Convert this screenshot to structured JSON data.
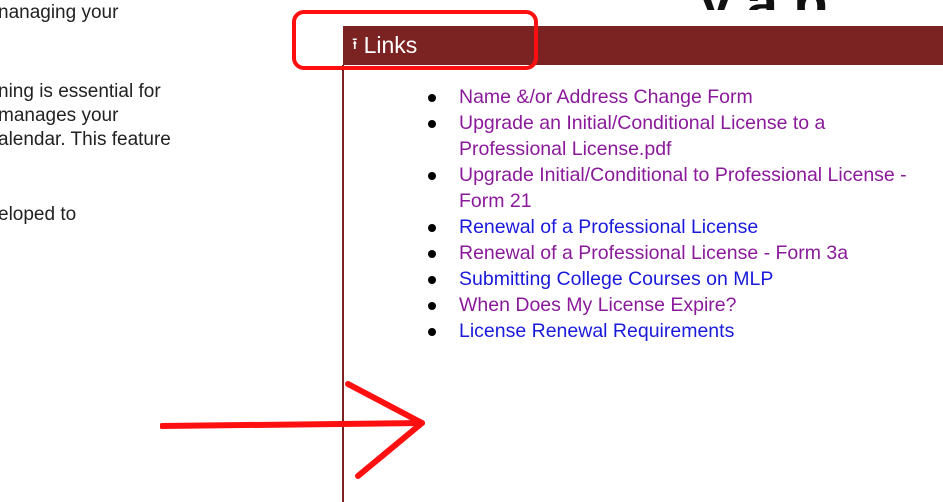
{
  "left_column": {
    "lines": [
      "nanaging your",
      "ning is essential for",
      "manages your",
      "alendar. This feature",
      "eloped to"
    ]
  },
  "top_heading": {
    "text": "y  a  p"
  },
  "links_panel": {
    "header_label": "Links",
    "header_color": "#7a2322",
    "collapse_icon": "arrow-up-icon",
    "items": [
      {
        "label": "Name &/or Address Change Form",
        "state": "visited"
      },
      {
        "label": "Upgrade an Initial/Conditional License to a Professional License.pdf",
        "state": "visited"
      },
      {
        "label": "Upgrade Initial/Conditional to Professional License - Form 21",
        "state": "visited"
      },
      {
        "label": "Renewal of a Professional License",
        "state": "unvisited"
      },
      {
        "label": "Renewal of a Professional License - Form 3a",
        "state": "visited"
      },
      {
        "label": "Submitting College Courses on MLP",
        "state": "unvisited"
      },
      {
        "label": "When Does My License Expire?",
        "state": "visited"
      },
      {
        "label": "License Renewal Requirements",
        "state": "unvisited"
      }
    ]
  },
  "annotations": {
    "color": "#ff1010",
    "box_target": "links-header",
    "arrow_target": "when-does-my-license-expire"
  }
}
